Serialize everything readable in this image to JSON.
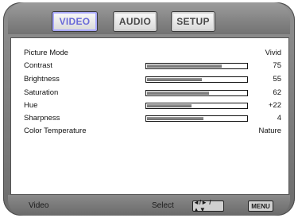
{
  "tabs": [
    {
      "label": "VIDEO",
      "active": true
    },
    {
      "label": "AUDIO",
      "active": false
    },
    {
      "label": "SETUP",
      "active": false
    }
  ],
  "settings": [
    {
      "label": "Picture Mode",
      "value": "Vivid"
    },
    {
      "label": "Contrast",
      "value": "75",
      "level": 0.75
    },
    {
      "label": "Brightness",
      "value": "55",
      "level": 0.55
    },
    {
      "label": "Saturation",
      "value": "62",
      "level": 0.62
    },
    {
      "label": "Hue",
      "value": "+22",
      "level": 0.45
    },
    {
      "label": "Sharpness",
      "value": "4",
      "level": 0.57
    },
    {
      "label": "Color Temperature",
      "value": "Nature"
    }
  ],
  "footer": {
    "left": "Video",
    "center": "Select",
    "nav_key": "◄/► / ▲▼",
    "menu_key": "MENU"
  },
  "colors": {
    "active_tab_text": "#6a6ad8",
    "frame": "#7c7c7c"
  }
}
